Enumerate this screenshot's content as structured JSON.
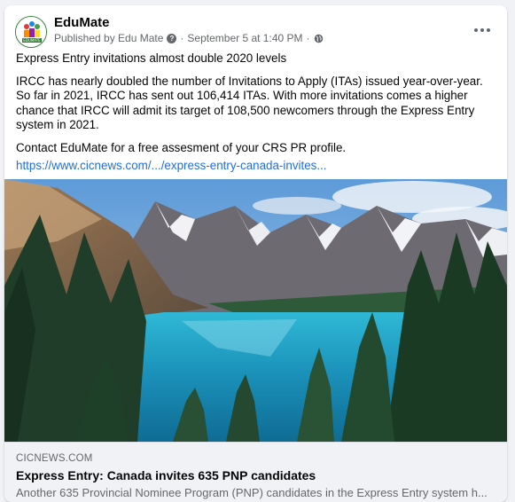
{
  "post": {
    "page_name": "EduMate",
    "published_by": "Published by Edu Mate",
    "separator": "·",
    "date": "September 5 at 1:40 PM",
    "paragraphs": [
      "Express Entry invitations almost double 2020 levels",
      "IRCC has nearly doubled the number of Invitations to Apply (ITAs) issued year-over-year. So far in 2021, IRCC has sent out 106,414 ITAs. With more invitations comes a higher chance that IRCC will admit its target of 108,500 newcomers through the Express Entry system in 2021.",
      "Contact EduMate for a free assesment of your CRS PR profile."
    ],
    "link_text": "https://www.cicnews.com/.../express-entry-canada-invites...",
    "link_color": "#216fdb"
  },
  "avatar_logo_text": "EDUMATE",
  "link_preview": {
    "domain": "CICNEWS.COM",
    "title": "Express Entry: Canada invites 635 PNP candidates",
    "description": "Another 635 Provincial Nominee Program (PNP) candidates in the Express Entry system h..."
  },
  "icons": {
    "info": "question-circle-icon",
    "audience": "globe-icon",
    "menu": "more-dots-icon"
  }
}
